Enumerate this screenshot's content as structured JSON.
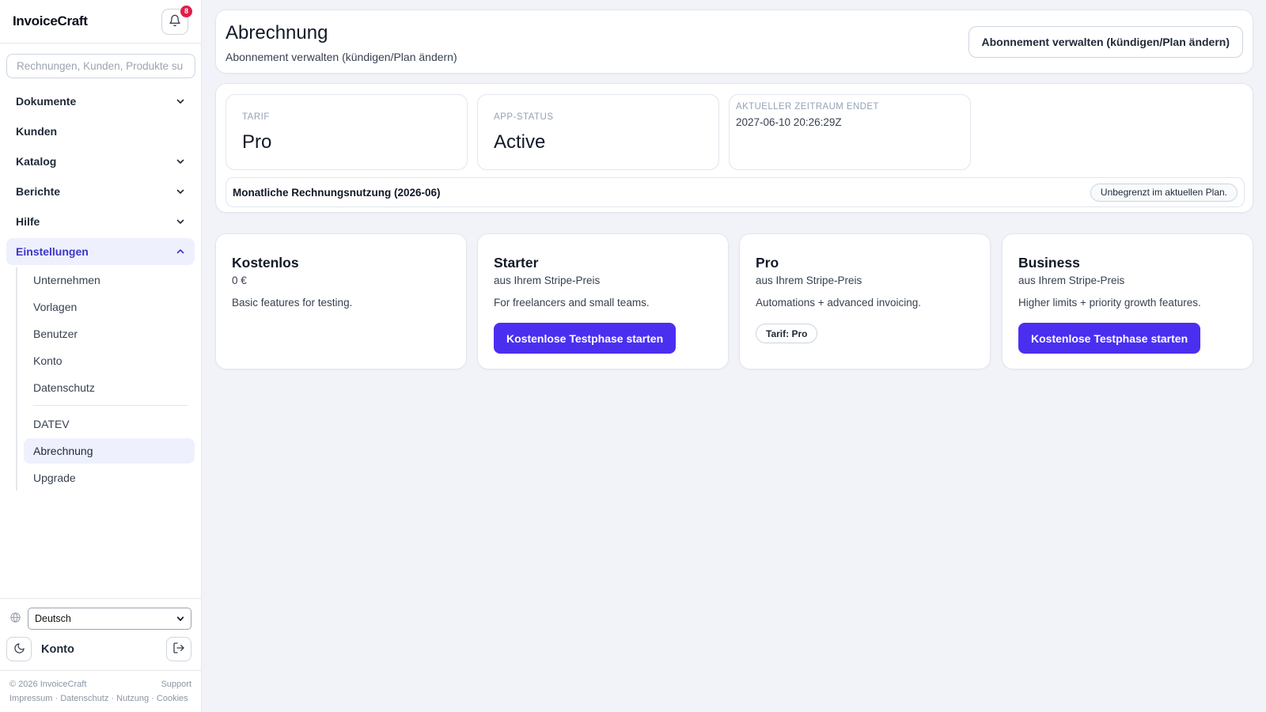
{
  "app": {
    "brand": "InvoiceCraft",
    "notification_count": "8"
  },
  "search": {
    "placeholder": "Rechnungen, Kunden, Produkte su"
  },
  "nav": [
    {
      "label": "Dokumente",
      "chevron": "down"
    },
    {
      "label": "Kunden",
      "chevron": ""
    },
    {
      "label": "Katalog",
      "chevron": "down"
    },
    {
      "label": "Berichte",
      "chevron": "down"
    },
    {
      "label": "Hilfe",
      "chevron": "down"
    },
    {
      "label": "Einstellungen",
      "chevron": "up"
    }
  ],
  "settings_sub": {
    "group1": [
      "Unternehmen",
      "Vorlagen",
      "Benutzer",
      "Konto",
      "Datenschutz"
    ],
    "group2": [
      "DATEV",
      "Abrechnung",
      "Upgrade"
    ],
    "active": "Abrechnung"
  },
  "bottom": {
    "language": "Deutsch",
    "account": "Konto"
  },
  "footer": {
    "copyright": "© 2026 InvoiceCraft",
    "support": "Support",
    "links": [
      "Impressum",
      "Datenschutz",
      "Nutzung",
      "Cookies"
    ]
  },
  "header": {
    "title": "Abrechnung",
    "subtitle": "Abonnement verwalten (kündigen/Plan ändern)",
    "manage_button": "Abonnement verwalten (kündigen/Plan ändern)"
  },
  "status": {
    "tarif_label": "TARIF",
    "tarif_value": "Pro",
    "app_status_label": "APP-STATUS",
    "app_status_value": "Active",
    "period_label": "AKTUELLER ZEITRAUM ENDET",
    "period_value": "2027-06-10 20:26:29Z",
    "usage_label": "Monatliche Rechnungsnutzung (2026-06)",
    "usage_value": "Unbegrenzt im aktuellen Plan."
  },
  "plans": [
    {
      "name": "Kostenlos",
      "price": "0 €",
      "desc": "Basic features for testing."
    },
    {
      "name": "Starter",
      "price": "aus Ihrem Stripe-Preis",
      "desc": "For freelancers and small teams.",
      "button": "Kostenlose Testphase starten"
    },
    {
      "name": "Pro",
      "price": "aus Ihrem Stripe-Preis",
      "desc": "Automations + advanced invoicing.",
      "pill": "Tarif: Pro"
    },
    {
      "name": "Business",
      "price": "aus Ihrem Stripe-Preis",
      "desc": "Higher limits + priority growth features.",
      "button": "Kostenlose Testphase starten"
    }
  ],
  "colors": {
    "accent": "#4b2ff0",
    "active_bg": "#eef0fd",
    "active_text": "#3d36c9",
    "badge": "#e11d48",
    "page_bg": "#f1f3f8"
  }
}
